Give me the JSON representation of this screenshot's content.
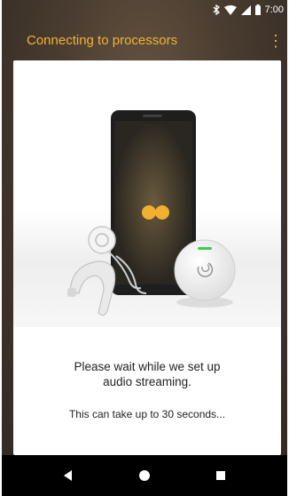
{
  "status_bar": {
    "time": "7:00",
    "icons": [
      "bluetooth-icon",
      "wifi-icon",
      "cell-signal-icon",
      "battery-icon"
    ]
  },
  "app_bar": {
    "title": "Connecting to processors",
    "menu_icon": "more-vert-icon"
  },
  "card": {
    "message_line1": "Please wait while we set up",
    "message_line2": "audio streaming.",
    "sub_message": "This can take up to 30 seconds..."
  },
  "nav_bar": {
    "back": "back-icon",
    "home": "home-icon",
    "recents": "recents-icon"
  },
  "colors": {
    "accent": "#f2b233",
    "background": "#3e3329",
    "card": "#ffffff",
    "navbar": "#000000"
  }
}
